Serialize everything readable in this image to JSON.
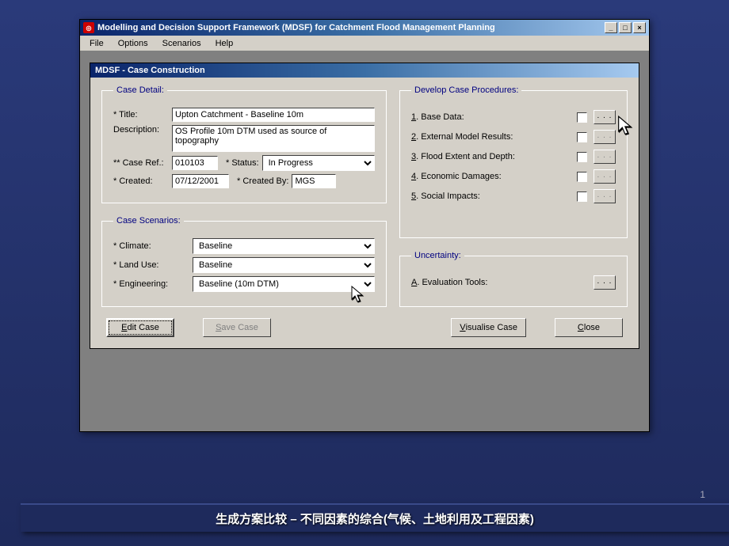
{
  "window": {
    "title": "Modelling and Decision Support Framework (MDSF) for Catchment Flood Management Planning",
    "menu": {
      "file": "File",
      "options": "Options",
      "scenarios": "Scenarios",
      "help": "Help"
    }
  },
  "dialog": {
    "title": "MDSF - Case Construction",
    "case_detail": {
      "legend": "Case Detail:",
      "title_label": "Title:",
      "title_value": "Upton Catchment - Baseline 10m",
      "desc_label": "Description:",
      "desc_value": "OS Profile 10m DTM used as source of topography",
      "caseref_label": "** Case Ref.:",
      "caseref_value": "010103",
      "status_label": "Status:",
      "status_value": "In Progress",
      "created_label": "Created:",
      "created_value": "07/12/2001",
      "createdby_label": "Created By:",
      "createdby_value": "MGS"
    },
    "scenarios": {
      "legend": "Case Scenarios:",
      "climate_label": "Climate:",
      "climate_value": "Baseline",
      "landuse_label": "Land Use:",
      "landuse_value": "Baseline",
      "eng_label": "Engineering:",
      "eng_value": "Baseline (10m DTM)"
    },
    "procedures": {
      "legend": "Develop Case Procedures:",
      "items": [
        {
          "num": "1",
          "label": "Base Data:"
        },
        {
          "num": "2",
          "label": "External Model Results:"
        },
        {
          "num": "3",
          "label": "Flood Extent and Depth:"
        },
        {
          "num": "4",
          "label": "Economic Damages:"
        },
        {
          "num": "5",
          "label": "Social Impacts:"
        }
      ]
    },
    "uncertainty": {
      "legend": "Uncertainty:",
      "eval_label": "Evaluation Tools:",
      "eval_key": "A"
    },
    "buttons": {
      "edit": "Edit Case",
      "save": "Save Case",
      "visualise": "Visualise Case",
      "close": "Close"
    }
  },
  "caption": "生成方案比较 – 不同因素的综合(气候、土地利用及工程因素)",
  "page_num": "1"
}
